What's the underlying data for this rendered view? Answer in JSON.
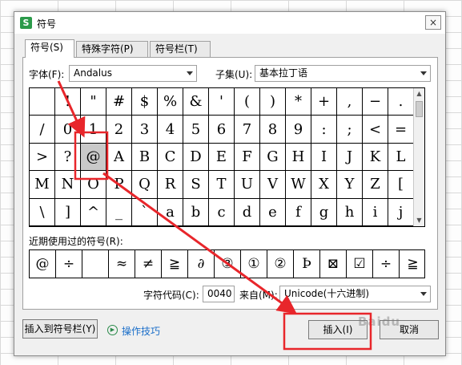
{
  "dialog": {
    "title": "符号",
    "app_icon_letter": "S",
    "close_glyph": "×"
  },
  "tabs": [
    {
      "label": "符号(S)",
      "active": true
    },
    {
      "label": "特殊字符(P)",
      "active": false
    },
    {
      "label": "符号栏(T)",
      "active": false
    }
  ],
  "font": {
    "label": "字体(F):",
    "value": "Andalus"
  },
  "subset": {
    "label": "子集(U):",
    "value": "基本拉丁语"
  },
  "symbols": [
    [
      "",
      "!",
      "\"",
      "#",
      "$",
      "%",
      "&",
      "'",
      "(",
      ")",
      "*",
      "+",
      ",",
      "−",
      "."
    ],
    [
      "/",
      "0",
      "1",
      "2",
      "3",
      "4",
      "5",
      "6",
      "7",
      "8",
      "9",
      ":",
      ";",
      "<",
      "="
    ],
    [
      ">",
      "?",
      "@",
      "A",
      "B",
      "C",
      "D",
      "E",
      "F",
      "G",
      "H",
      "I",
      "J",
      "K",
      "L"
    ],
    [
      "M",
      "N",
      "O",
      "P",
      "Q",
      "R",
      "S",
      "T",
      "U",
      "V",
      "W",
      "X",
      "Y",
      "Z",
      "["
    ],
    [
      "\\",
      "]",
      "^",
      "_",
      "`",
      "a",
      "b",
      "c",
      "d",
      "e",
      "f",
      "g",
      "h",
      "i",
      "j"
    ]
  ],
  "selected_symbol": "@",
  "recent": {
    "label": "近期使用过的符号(R):",
    "items": [
      "@",
      "÷",
      "",
      "≈",
      "≠",
      "≧",
      "∂",
      "③",
      "①",
      "②",
      "Þ",
      "⊠",
      "☑",
      "÷",
      "≧"
    ]
  },
  "char_code": {
    "label": "字符代码(C):",
    "value": "0040"
  },
  "from": {
    "label": "来自(M):",
    "value": "Unicode(十六进制)"
  },
  "buttons": {
    "insert_to_bar": "插入到符号栏(Y)",
    "tips": "操作技巧",
    "insert": "插入(I)",
    "cancel": "取消"
  },
  "watermark": "Baidu",
  "colors": {
    "annotation_red": "#e8262b",
    "dialog_bg": "#f0f0f0",
    "link_blue": "#1a6ec9"
  }
}
